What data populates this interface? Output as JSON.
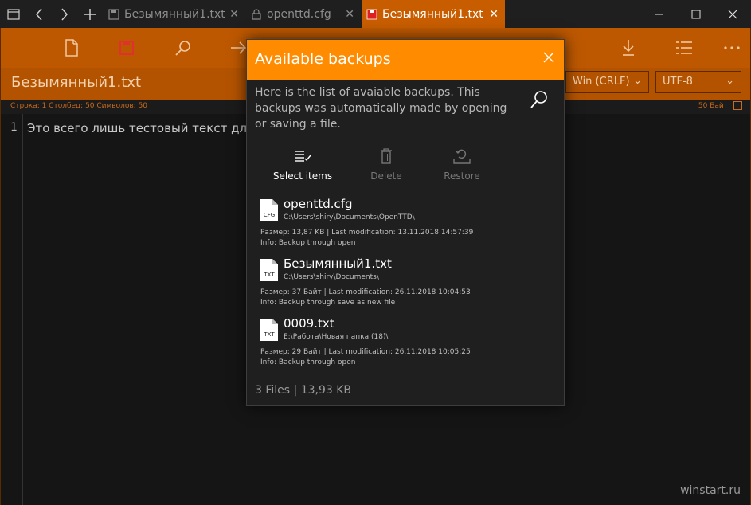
{
  "titlebar": {
    "tabs": [
      {
        "label": "Безымянный1.txt",
        "active": false
      },
      {
        "label": "openttd.cfg",
        "active": false
      },
      {
        "label": "Безымянный1.txt",
        "active": true
      }
    ],
    "close_glyph": "✕",
    "window_controls": {
      "minimize": "—",
      "maximize": "☐",
      "close": "✕"
    }
  },
  "toolbar": {
    "icons": [
      "new-file-icon",
      "save-icon",
      "search-icon",
      "go-to-icon",
      "download-icon",
      "list-icon",
      "more-icon"
    ]
  },
  "filebar": {
    "filename": "Безымянный1.txt",
    "line_ending": "Win (CRLF)",
    "encoding": "UTF-8"
  },
  "status": {
    "left": "Строка: 1  Столбец: 50  Символов: 50",
    "right": "50 Байт"
  },
  "editor": {
    "line_number": "1",
    "line_text": "Это всего лишь тестовый текст для ww"
  },
  "watermark": "winstart.ru",
  "dialog": {
    "title": "Available backups",
    "description": "Here is the list of avaiable backups. This backups was automatically made by opening or saving a file.",
    "actions": {
      "select": "Select items",
      "delete": "Delete",
      "restore": "Restore"
    },
    "files": [
      {
        "type": "CFG",
        "name": "openttd.cfg",
        "path": "C:\\Users\\shiry\\Documents\\OpenTTD\\",
        "meta": "Размер: 13,87 KB | Last modification: 13.11.2018 14:57:39",
        "info": "Info: Backup through open"
      },
      {
        "type": "TXT",
        "name": "Безымянный1.txt",
        "path": "C:\\Users\\shiry\\Documents\\",
        "meta": "Размер: 37 Байт | Last modification: 26.11.2018 10:04:53",
        "info": "Info: Backup through save as new file"
      },
      {
        "type": "TXT",
        "name": "0009.txt",
        "path": "E:\\Работа\\Новая папка (18)\\",
        "meta": "Размер: 29 Байт | Last modification: 26.11.2018 10:05:25",
        "info": "Info: Backup through open"
      }
    ],
    "footer": "3 Files | 13,93 KB"
  },
  "colors": {
    "accent": "#ff8c00",
    "toolbar": "#bd5800",
    "background": "#1a1a1a"
  }
}
